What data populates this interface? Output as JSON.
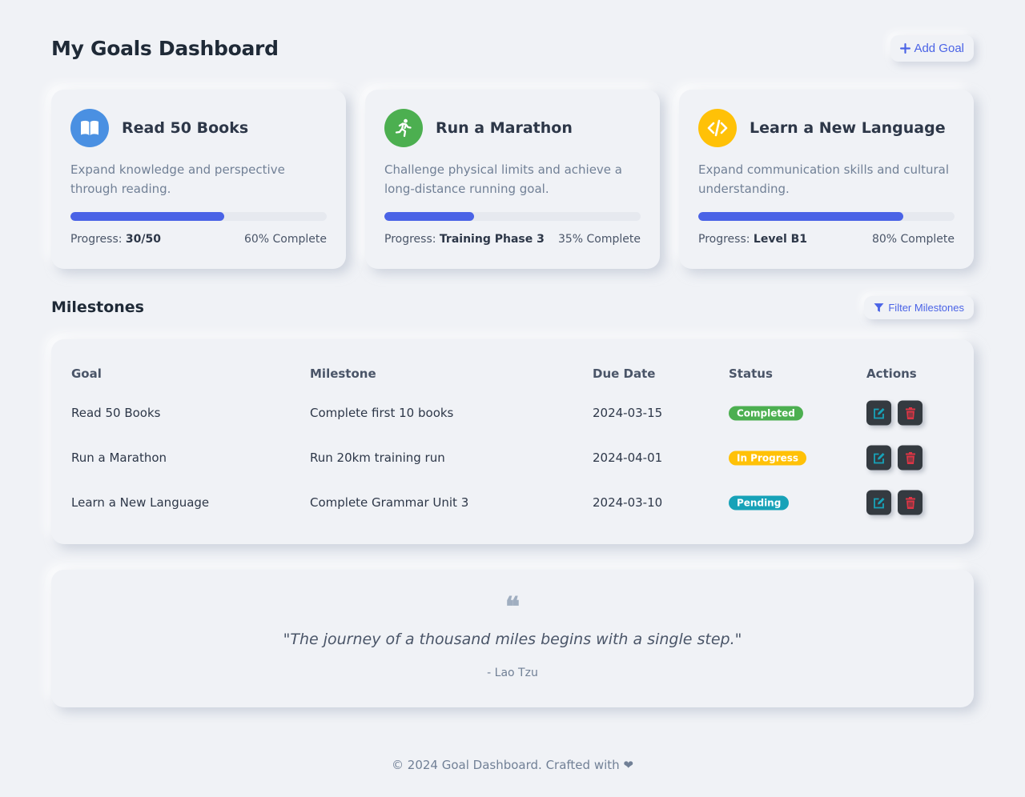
{
  "header": {
    "title": "My Goals Dashboard",
    "add_label": "Add Goal",
    "add_icon": "plus-icon"
  },
  "colors": {
    "accent": "#4a63e6",
    "completed": "#4caf50",
    "in_progress": "#ffc107",
    "pending": "#17a2b8",
    "action_bg": "#343a40",
    "edit_icon": "#17a2b8",
    "delete_icon": "#dc3545"
  },
  "goals": [
    {
      "title": "Read 50 Books",
      "description": "Expand knowledge and perspective through reading.",
      "progress_label": "Progress:",
      "progress_value": "30/50",
      "percent_text": "60% Complete",
      "progress": 0.6,
      "icon": "book-icon",
      "icon_color": "#4a90e2"
    },
    {
      "title": "Run a Marathon",
      "description": "Challenge physical limits and achieve a long-distance running goal.",
      "progress_label": "Progress:",
      "progress_value": "Training Phase 3",
      "percent_text": "35% Complete",
      "progress": 0.35,
      "icon": "running-icon",
      "icon_color": "#4caf50"
    },
    {
      "title": "Learn a New Language",
      "description": "Expand communication skills and cultural understanding.",
      "progress_label": "Progress:",
      "progress_value": "Level B1",
      "percent_text": "80% Complete",
      "progress": 0.8,
      "icon": "code-icon",
      "icon_color": "#ffc107"
    }
  ],
  "milestones": {
    "title": "Milestones",
    "filter_label": "Filter Milestones",
    "filter_icon": "filter-icon",
    "columns": [
      "Goal",
      "Milestone",
      "Due Date",
      "Status",
      "Actions"
    ],
    "rows": [
      {
        "goal": "Read 50 Books",
        "milestone": "Complete first 10 books",
        "due": "2024-03-15",
        "status": "Completed",
        "status_color": "#4caf50"
      },
      {
        "goal": "Run a Marathon",
        "milestone": "Run 20km training run",
        "due": "2024-04-01",
        "status": "In Progress",
        "status_color": "#ffc107"
      },
      {
        "goal": "Learn a New Language",
        "milestone": "Complete Grammar Unit 3",
        "due": "2024-03-10",
        "status": "Pending",
        "status_color": "#17a2b8"
      }
    ]
  },
  "quote": {
    "mark": "❝",
    "text": "\"The journey of a thousand miles begins with a single step.\"",
    "author": "- Lao Tzu"
  },
  "footer": {
    "text": "© 2024 Goal Dashboard. Crafted with ❤"
  }
}
